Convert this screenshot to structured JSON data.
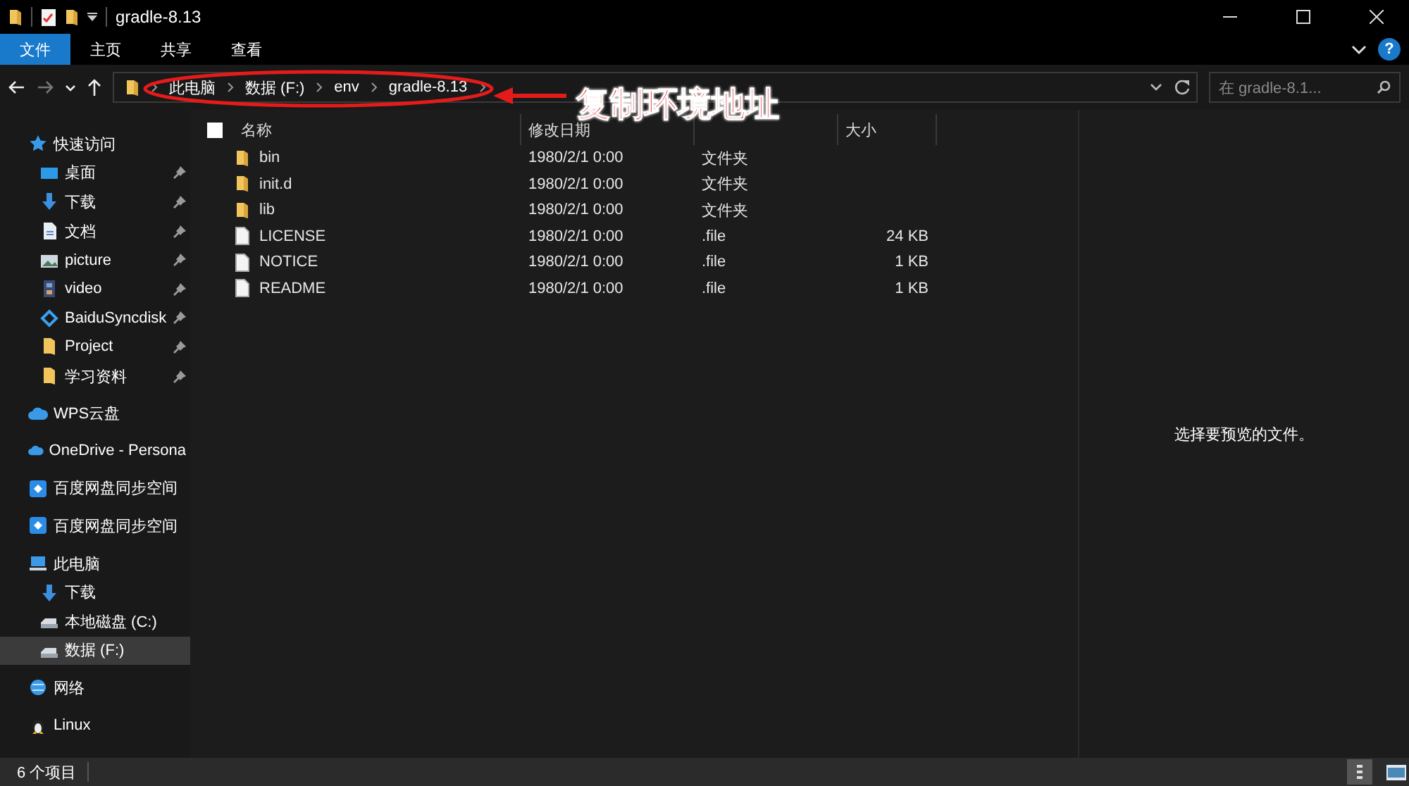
{
  "window": {
    "title": "gradle-8.13"
  },
  "ribbon": {
    "tabs": [
      {
        "label": "文件",
        "selected": true
      },
      {
        "label": "主页",
        "selected": false
      },
      {
        "label": "共享",
        "selected": false
      },
      {
        "label": "查看",
        "selected": false
      }
    ],
    "help": "?"
  },
  "address": {
    "crumbs": [
      "此电脑",
      "数据 (F:)",
      "env",
      "gradle-8.13"
    ]
  },
  "search": {
    "placeholder": "在 gradle-8.1..."
  },
  "sidebar": {
    "items": [
      {
        "label": "快速访问",
        "kind": "star",
        "selected": false,
        "children": [
          {
            "label": "桌面",
            "kind": "desktop",
            "pinned": true,
            "selected": false
          },
          {
            "label": "下载",
            "kind": "download",
            "pinned": true,
            "selected": false
          },
          {
            "label": "文档",
            "kind": "document",
            "pinned": true,
            "selected": false
          },
          {
            "label": "picture",
            "kind": "image",
            "pinned": true,
            "selected": false
          },
          {
            "label": "video",
            "kind": "film",
            "pinned": true,
            "selected": false
          },
          {
            "label": "BaiduSyncdisk",
            "kind": "diamond",
            "pinned": true,
            "selected": false
          },
          {
            "label": "Project",
            "kind": "folder",
            "pinned": true,
            "selected": false
          },
          {
            "label": "学习资料",
            "kind": "folder",
            "pinned": true,
            "selected": false
          }
        ]
      },
      {
        "label": "WPS云盘",
        "kind": "cloud",
        "selected": false
      },
      {
        "label": "OneDrive - Persona",
        "kind": "cloud",
        "selected": false
      },
      {
        "label": "百度网盘同步空间",
        "kind": "sync",
        "selected": false
      },
      {
        "label": "百度网盘同步空间",
        "kind": "sync",
        "selected": false
      },
      {
        "label": "此电脑",
        "kind": "computer",
        "selected": false,
        "children": [
          {
            "label": "下载",
            "kind": "download",
            "selected": false
          },
          {
            "label": "本地磁盘 (C:)",
            "kind": "drive",
            "selected": false
          },
          {
            "label": "数据 (F:)",
            "kind": "drive",
            "selected": true
          }
        ]
      },
      {
        "label": "网络",
        "kind": "network",
        "selected": false
      },
      {
        "label": "Linux",
        "kind": "penguin",
        "selected": false
      }
    ]
  },
  "table": {
    "select_all": {
      "checked": false
    },
    "columns": [
      "名称",
      "修改日期",
      "",
      "大小"
    ],
    "rows": [
      {
        "name": "bin",
        "kind": "folder",
        "modified": "1980/2/1 0:00",
        "type": "文件夹",
        "size": ""
      },
      {
        "name": "init.d",
        "kind": "folder",
        "modified": "1980/2/1 0:00",
        "type": "文件夹",
        "size": ""
      },
      {
        "name": "lib",
        "kind": "folder",
        "modified": "1980/2/1 0:00",
        "type": "文件夹",
        "size": ""
      },
      {
        "name": "LICENSE",
        "kind": "file",
        "modified": "1980/2/1 0:00",
        "type": ".file",
        "size": "24 KB"
      },
      {
        "name": "NOTICE",
        "kind": "file",
        "modified": "1980/2/1 0:00",
        "type": ".file",
        "size": "1 KB"
      },
      {
        "name": "README",
        "kind": "file",
        "modified": "1980/2/1 0:00",
        "type": ".file",
        "size": "1 KB"
      }
    ]
  },
  "preview": {
    "message": "选择要预览的文件。"
  },
  "status_bar": {
    "count": "6 个项目",
    "views": [
      {
        "kind": "details",
        "selected": true
      },
      {
        "kind": "large-icons",
        "selected": false
      }
    ]
  },
  "annotation": {
    "text": "复制环境地址"
  }
}
